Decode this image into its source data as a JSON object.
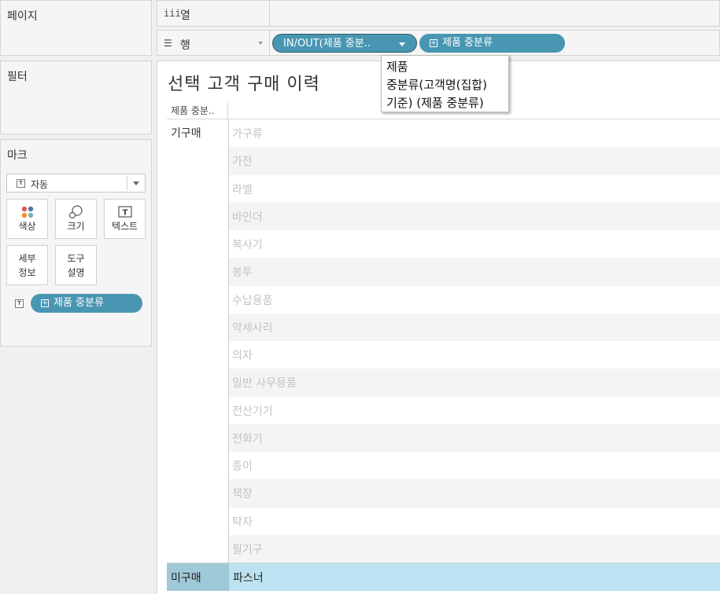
{
  "left_panels": {
    "pages_title": "페이지",
    "filters_title": "필터",
    "marks_title": "마크",
    "marks_type": "자동",
    "buttons": {
      "color": "색상",
      "size": "크기",
      "text": "텍스트",
      "detail": "세부\n정보",
      "tooltip": "도구\n설명"
    },
    "marks_pill": "제품 중분류"
  },
  "shelves": {
    "columns_label": "열",
    "rows_label": "행",
    "rows_pills": [
      "IN/OUT(제품 중분..",
      "제품 중분류"
    ]
  },
  "tooltip": {
    "lines": [
      "제품",
      "중분류(고객명(집합)",
      "기준) (제품 중분류)"
    ]
  },
  "viz": {
    "title": "선택 고객 구매 이력",
    "column_header": "제품 중분..",
    "group_purchased": "기구매",
    "group_not_purchased": "미구매",
    "purchased_items": [
      "가구류",
      "가전",
      "라벨",
      "바인더",
      "복사기",
      "봉투",
      "수납용품",
      "악세사리",
      "의자",
      "일반 사무용품",
      "전산기기",
      "전화기",
      "종이",
      "책장",
      "탁자",
      "필기구"
    ],
    "not_purchased_items": [
      "파스너"
    ]
  },
  "colors": {
    "pill": "#4996b2",
    "selected_row": "#bde2f2",
    "selected_group": "#9fc9d9"
  }
}
